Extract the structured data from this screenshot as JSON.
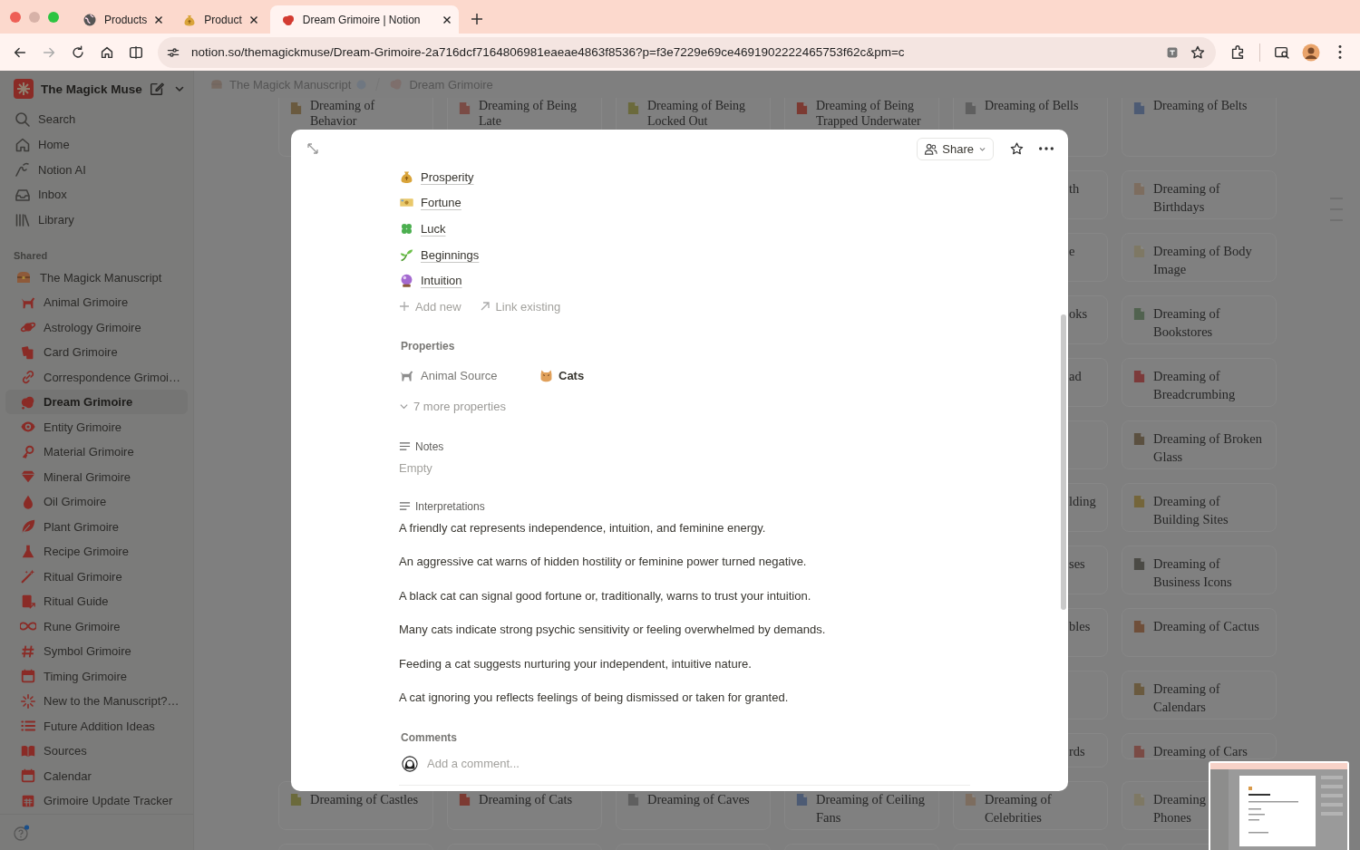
{
  "browser": {
    "tabs": [
      {
        "title": "Products",
        "selected": false
      },
      {
        "title": "Product",
        "selected": false
      },
      {
        "title": "Dream Grimoire | Notion",
        "selected": true
      }
    ],
    "url": "notion.so/themagickmuse/Dream-Grimoire-2a716dcf7164806981eaeae4863f8536?p=f3e7229e69ce4691902222465753f62c&pm=c"
  },
  "sidebar": {
    "workspace": "The Magick Muse",
    "nav": [
      {
        "label": "Search"
      },
      {
        "label": "Home"
      },
      {
        "label": "Notion AI"
      },
      {
        "label": "Inbox"
      },
      {
        "label": "Library"
      }
    ],
    "section": "Shared",
    "tree": [
      {
        "label": "The Magick Manuscript",
        "selected": false,
        "children": [
          {
            "label": "Animal Grimoire",
            "selected": false
          },
          {
            "label": "Astrology Grimoire",
            "selected": false
          },
          {
            "label": "Card Grimoire",
            "selected": false
          },
          {
            "label": "Correspondence Grimoi…",
            "selected": false
          },
          {
            "label": "Dream Grimoire",
            "selected": true
          },
          {
            "label": "Entity Grimoire",
            "selected": false
          },
          {
            "label": "Material Grimoire",
            "selected": false
          },
          {
            "label": "Mineral Grimoire",
            "selected": false
          },
          {
            "label": "Oil Grimoire",
            "selected": false
          },
          {
            "label": "Plant Grimoire",
            "selected": false
          },
          {
            "label": "Recipe Grimoire",
            "selected": false
          },
          {
            "label": "Ritual Grimoire",
            "selected": false
          },
          {
            "label": "Ritual Guide",
            "selected": false
          },
          {
            "label": "Rune Grimoire",
            "selected": false
          },
          {
            "label": "Symbol Grimoire",
            "selected": false
          },
          {
            "label": "Timing Grimoire",
            "selected": false
          },
          {
            "label": "New to the Manuscript?…",
            "selected": false
          },
          {
            "label": "Future Addition Ideas",
            "selected": false
          },
          {
            "label": "Sources",
            "selected": false
          },
          {
            "label": "Calendar",
            "selected": false
          },
          {
            "label": "Grimoire Update Tracker",
            "selected": false
          }
        ]
      }
    ]
  },
  "topbar": {
    "breadcrumbs": [
      "The Magick Manuscript",
      "Dream Grimoire"
    ]
  },
  "board": {
    "top_row": [
      "Dreaming of Behavior",
      "Dreaming of Being Late",
      "Dreaming of Being Locked Out",
      "Dreaming of Being Trapped Underwater",
      "Dreaming of Bells",
      "Dreaming of Belts"
    ],
    "right_rows": [
      {
        "fragment": "th",
        "title": "Dreaming of Birthdays"
      },
      {
        "fragment": "e",
        "title": "Dreaming of Body Image"
      },
      {
        "fragment": "oks",
        "title": "Dreaming of Bookstores"
      },
      {
        "fragment": "ad",
        "title": "Dreaming of Breadcrumbing"
      },
      {
        "title": "Dreaming of Broken Glass"
      },
      {
        "fragment": "lding",
        "title": "Dreaming of Building Sites"
      },
      {
        "fragment": "ses",
        "title": "Dreaming of Business Icons"
      },
      {
        "fragment": "bles",
        "title": "Dreaming of Cactus"
      },
      {
        "title": "Dreaming of Calendars"
      },
      {
        "fragment": "rds",
        "title": "Dreaming of Cars"
      }
    ],
    "bottom_row": [
      "Dreaming of Castles",
      "Dreaming of Cats",
      "Dreaming of Caves",
      "Dreaming of Ceiling Fans",
      "Dreaming of Celebrities",
      "Dreaming\nPhones"
    ]
  },
  "modal": {
    "share": "Share",
    "relations": [
      "Prosperity",
      "Fortune",
      "Luck",
      "Beginnings",
      "Intuition"
    ],
    "add_new": "Add new",
    "link_existing": "Link existing",
    "properties_label": "Properties",
    "properties": [
      {
        "name": "Animal Source",
        "value": "Cats"
      }
    ],
    "more_properties": "7 more properties",
    "notes": {
      "label": "Notes",
      "empty_text": "Empty"
    },
    "interpretations": {
      "label": "Interpretations",
      "paragraphs": [
        "A friendly cat represents independence, intuition, and feminine energy.",
        "An aggressive cat warns of hidden hostility or feminine power turned negative.",
        "A black cat can signal good fortune or, traditionally, warns to trust your intuition.",
        "Many cats indicate strong psychic sensitivity or feeling overwhelmed by demands.",
        "Feeding a cat suggests nurturing your independent, intuitive nature.",
        "A cat ignoring you reflects feelings of being dismissed or taken for granted."
      ]
    },
    "comments": {
      "label": "Comments",
      "placeholder": "Add a comment..."
    }
  }
}
